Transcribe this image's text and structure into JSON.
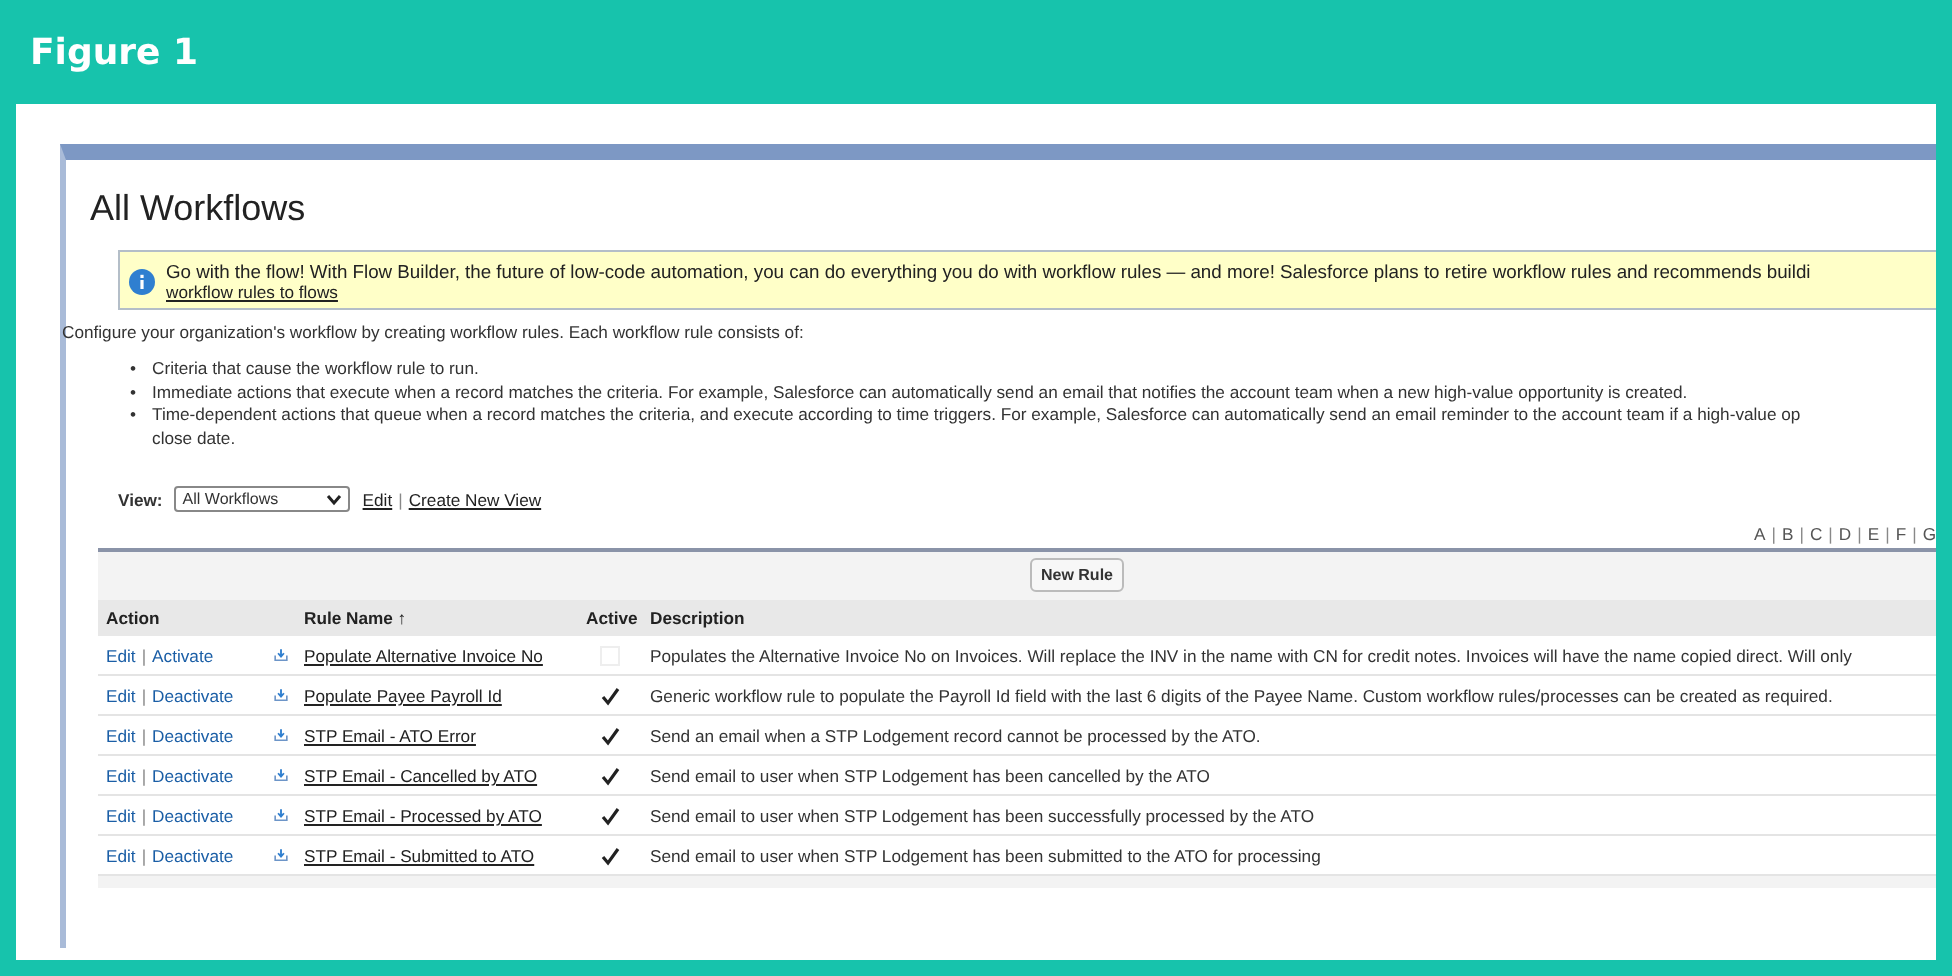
{
  "figure_label": "Figure 1",
  "separator": "|",
  "bullet_marker": "•",
  "title": "All Workflows",
  "banner": {
    "text": "Go with the flow! With Flow Builder, the future of low-code automation, you can do everything you do with workflow rules — and more! Salesforce plans to retire workflow rules and recommends buildi",
    "link": "workflow rules to flows"
  },
  "intro": "Configure your organization's workflow by creating workflow rules. Each workflow rule consists of:",
  "bullets": [
    "Criteria that cause the workflow rule to run.",
    "Immediate actions that execute when a record matches the criteria. For example, Salesforce can automatically send an email that notifies the account team when a new high-value opportunity is created.",
    "Time-dependent actions that queue when a record matches the criteria, and execute according to time triggers. For example, Salesforce can automatically send an email reminder to the account team if a high-value op\nclose date."
  ],
  "view": {
    "label": "View:",
    "value": "All Workflows",
    "links": [
      "Edit",
      "Create New View"
    ]
  },
  "alphabet": [
    "A",
    "B",
    "C",
    "D",
    "E",
    "F",
    "G"
  ],
  "new_rule_button": "New Rule",
  "table": {
    "columns": [
      "Action",
      "Rule Name ↑",
      "Active",
      "Description"
    ],
    "rows": [
      {
        "actions": [
          "Edit",
          "Activate"
        ],
        "name": "Populate Alternative Invoice No",
        "active": false,
        "description": "Populates the Alternative Invoice No on Invoices. Will replace the INV in the name with CN for credit notes. Invoices will have the name copied direct. Will only"
      },
      {
        "actions": [
          "Edit",
          "Deactivate"
        ],
        "name": "Populate Payee Payroll Id",
        "active": true,
        "description": "Generic workflow rule to populate the Payroll Id field with the last 6 digits of the Payee Name. Custom workflow rules/processes can be created as required."
      },
      {
        "actions": [
          "Edit",
          "Deactivate"
        ],
        "name": "STP Email - ATO Error",
        "active": true,
        "description": "Send an email when a STP Lodgement record cannot be processed by the ATO."
      },
      {
        "actions": [
          "Edit",
          "Deactivate"
        ],
        "name": "STP Email - Cancelled by ATO",
        "active": true,
        "description": "Send email to user when STP Lodgement has been cancelled by the ATO"
      },
      {
        "actions": [
          "Edit",
          "Deactivate"
        ],
        "name": "STP Email - Processed by ATO",
        "active": true,
        "description": "Send email to user when STP Lodgement has been successfully processed by the ATO"
      },
      {
        "actions": [
          "Edit",
          "Deactivate"
        ],
        "name": "STP Email - Submitted to ATO",
        "active": true,
        "description": "Send email to user when STP Lodgement has been submitted to the ATO for processing"
      }
    ]
  }
}
